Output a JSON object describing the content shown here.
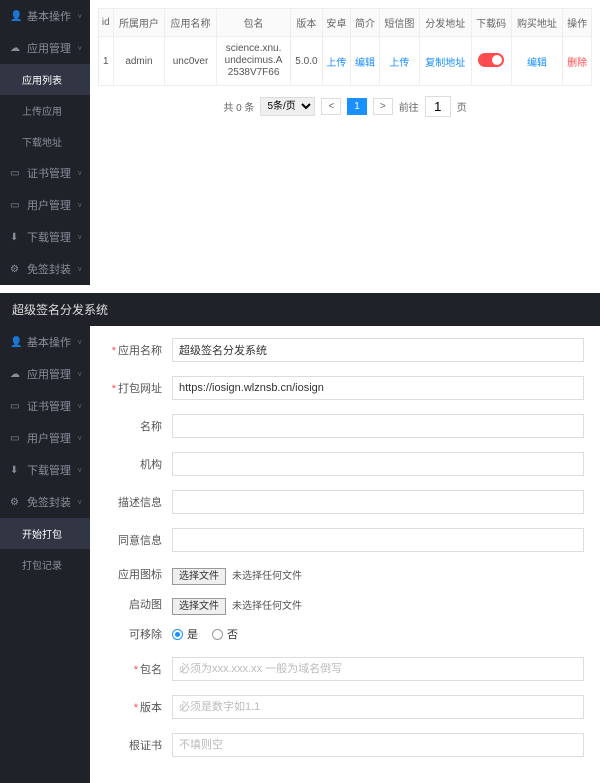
{
  "top": {
    "sidebar": [
      {
        "label": "基本操作",
        "icon": "👤",
        "sub": false,
        "active": false,
        "exp": true
      },
      {
        "label": "应用管理",
        "icon": "☁",
        "sub": false,
        "active": false,
        "exp": true
      },
      {
        "label": "应用列表",
        "icon": "",
        "sub": true,
        "active": true
      },
      {
        "label": "上传应用",
        "icon": "",
        "sub": true,
        "active": false
      },
      {
        "label": "下载地址",
        "icon": "",
        "sub": true,
        "active": false
      },
      {
        "label": "证书管理",
        "icon": "▭",
        "sub": false,
        "active": false,
        "exp": true
      },
      {
        "label": "用户管理",
        "icon": "▭",
        "sub": false,
        "active": false,
        "exp": true
      },
      {
        "label": "下载管理",
        "icon": "⬇",
        "sub": false,
        "active": false,
        "exp": true
      },
      {
        "label": "免签封装",
        "icon": "⚙",
        "sub": false,
        "active": false,
        "exp": true
      }
    ],
    "table": {
      "headers": [
        "id",
        "所属用户",
        "应用名称",
        "包名",
        "版本",
        "安卓",
        "简介",
        "短信图",
        "分发地址",
        "下载码",
        "购买地址",
        "操作"
      ],
      "row": {
        "id": "1",
        "user": "admin",
        "name": "unc0ver",
        "pkg": "science.xnu.undecimus.A2538V7F66",
        "ver": "5.0.0",
        "android": "上传",
        "intro": "编辑",
        "sms": "上传",
        "dist": "复制地址",
        "dl": "编辑",
        "buy": "删除"
      }
    },
    "pager": {
      "total": "共 0 条",
      "per": "5条/页",
      "prev": "<",
      "page": "1",
      "next": ">",
      "goto": "前往",
      "pgval": "1",
      "unit": "页"
    }
  },
  "bottom": {
    "title": "超级签名分发系统",
    "sidebar": [
      {
        "label": "基本操作",
        "icon": "👤",
        "sub": false,
        "exp": true
      },
      {
        "label": "应用管理",
        "icon": "☁",
        "sub": false,
        "exp": true
      },
      {
        "label": "证书管理",
        "icon": "▭",
        "sub": false,
        "exp": true
      },
      {
        "label": "用户管理",
        "icon": "▭",
        "sub": false,
        "exp": true
      },
      {
        "label": "下载管理",
        "icon": "⬇",
        "sub": false,
        "exp": true
      },
      {
        "label": "免签封装",
        "icon": "⚙",
        "sub": false,
        "exp": true,
        "open": true
      },
      {
        "label": "开始打包",
        "icon": "",
        "sub": true,
        "active": true
      },
      {
        "label": "打包记录",
        "icon": "",
        "sub": true
      }
    ],
    "form": {
      "appname": {
        "label": "应用名称",
        "value": "超级签名分发系统",
        "req": true
      },
      "url": {
        "label": "打包网址",
        "value": "https://iosign.wlznsb.cn/iosign",
        "req": true
      },
      "name": {
        "label": "名称"
      },
      "org": {
        "label": "机构"
      },
      "desc": {
        "label": "描述信息"
      },
      "consent": {
        "label": "同意信息"
      },
      "icon": {
        "label": "应用图标",
        "btn": "选择文件",
        "txt": "未选择任何文件"
      },
      "launch": {
        "label": "启动图",
        "btn": "选择文件",
        "txt": "未选择任何文件"
      },
      "remove": {
        "label": "可移除",
        "yes": "是",
        "no": "否"
      },
      "pkg": {
        "label": "包名",
        "ph": "必须为xxx.xxx.xx 一般为域名倒写",
        "req": true
      },
      "ver": {
        "label": "版本",
        "ph": "必须是数字如1.1",
        "req": true
      },
      "cert": {
        "label": "根证书",
        "ph": "不填则空"
      }
    }
  }
}
